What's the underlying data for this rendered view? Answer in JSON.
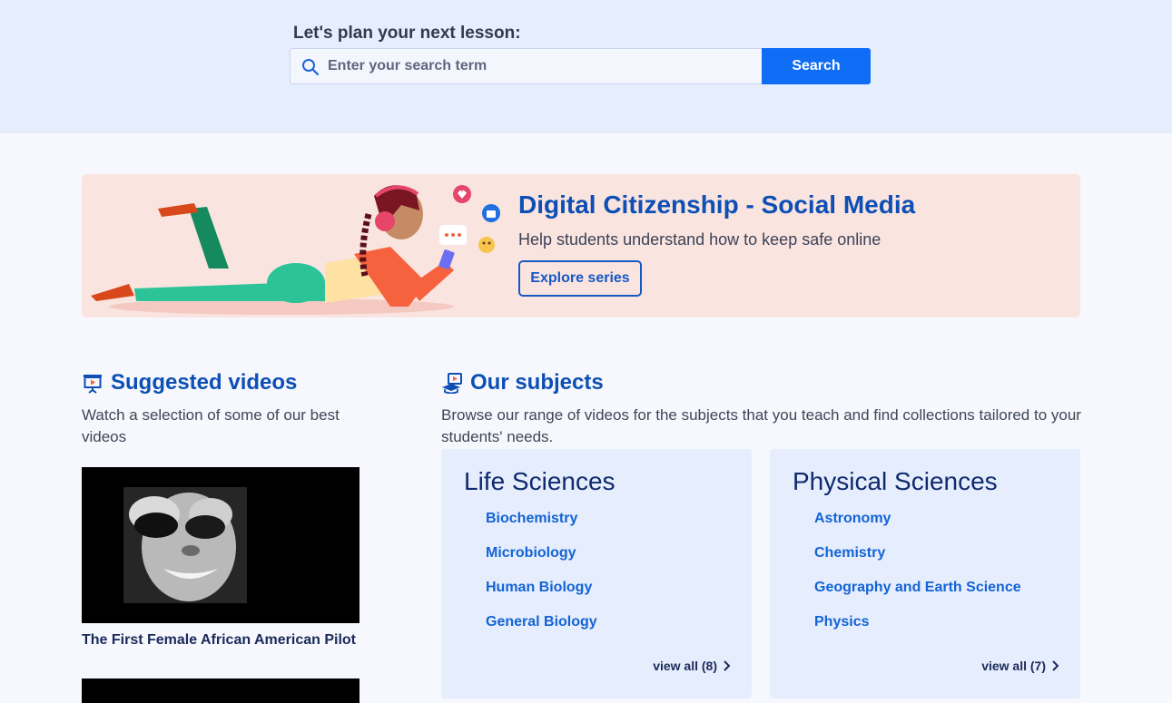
{
  "search": {
    "title": "Let's plan your next lesson:",
    "placeholder": "Enter your search term",
    "value": "",
    "button_label": "Search",
    "icon": "search-icon"
  },
  "banner": {
    "title": "Digital Citizenship - Social Media",
    "subtitle": "Help students understand how to keep safe online",
    "button_label": "Explore series",
    "background_color": "#fae4e0"
  },
  "suggested": {
    "title": "Suggested videos",
    "description": "Watch a selection of some of our best videos",
    "icon": "presentation-video-icon",
    "videos": [
      {
        "title": "The First Female African American Pilot"
      }
    ]
  },
  "subjects": {
    "title": "Our subjects",
    "description": "Browse our range of videos for the subjects that you teach and find collections tailored to your students' needs.",
    "icon": "subjects-video-icon",
    "cards": [
      {
        "title": "Life Sciences",
        "links": [
          "Biochemistry",
          "Microbiology",
          "Human Biology",
          "General Biology"
        ],
        "view_all": "view all (8)"
      },
      {
        "title": "Physical Sciences",
        "links": [
          "Astronomy",
          "Chemistry",
          "Geography and Earth Science",
          "Physics"
        ],
        "view_all": "view all (7)"
      }
    ]
  },
  "colors": {
    "accent": "#0f6cf5",
    "heading": "#0d4fb4",
    "link": "#1364d6",
    "band": "#e6edfc",
    "page": "#f6f8fd"
  }
}
